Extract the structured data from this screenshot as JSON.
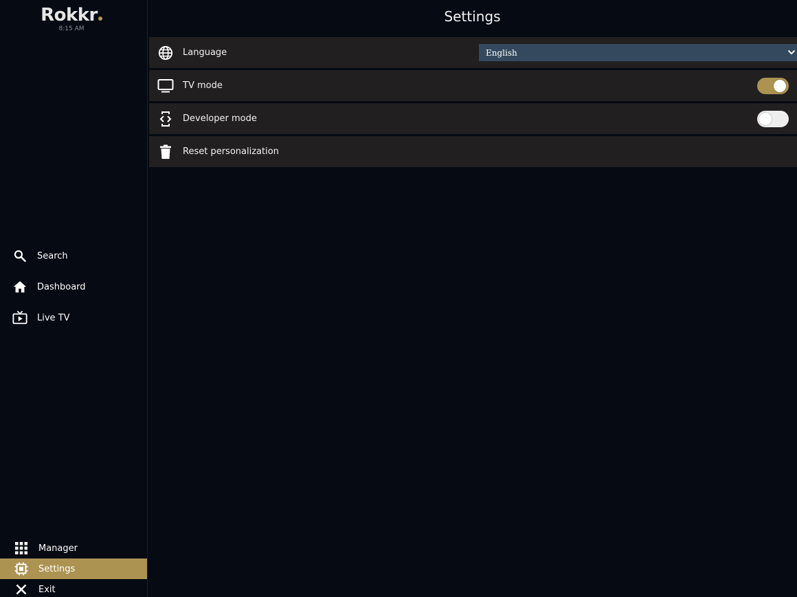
{
  "brand": {
    "logo": "Rokkr",
    "clock": "8:15 AM"
  },
  "page": {
    "title": "Settings"
  },
  "sidebar": {
    "top_items": [
      {
        "label": "Search",
        "icon": "search-icon"
      },
      {
        "label": "Dashboard",
        "icon": "home-icon"
      },
      {
        "label": "Live TV",
        "icon": "live-tv-icon"
      }
    ],
    "bottom_items": [
      {
        "label": "Manager",
        "icon": "grid-icon"
      },
      {
        "label": "Settings",
        "icon": "settings-chip-icon",
        "active": true
      },
      {
        "label": "Exit",
        "icon": "close-icon"
      }
    ]
  },
  "settings": {
    "language": {
      "label": "Language",
      "icon": "globe-icon",
      "selected": "English"
    },
    "tv_mode": {
      "label": "TV mode",
      "icon": "monitor-icon",
      "enabled": true
    },
    "developer_mode": {
      "label": "Developer mode",
      "icon": "developer-icon",
      "enabled": false
    },
    "reset": {
      "label": "Reset personalization",
      "icon": "trash-icon"
    }
  },
  "colors": {
    "background": "#050a13",
    "row": "#221f20",
    "accent": "#ad9352",
    "select": "#34495e"
  }
}
